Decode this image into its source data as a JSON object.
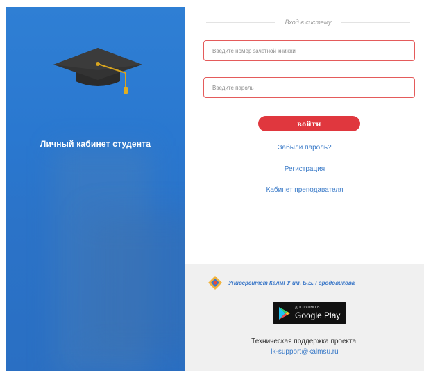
{
  "left_panel": {
    "title": "Личный кабинет студента",
    "icon": "graduation-cap-icon",
    "background_color": "#2b78d0"
  },
  "form": {
    "legend": "Вход в систему",
    "gradebook_placeholder": "Введите номер зачетной книжки",
    "password_placeholder": "Введите пароль",
    "login_label": "войти",
    "accent_color": "#e0373e"
  },
  "links": {
    "forgot_password": "Забыли пароль?",
    "registration": "Регистрация",
    "teacher_cabinet": "Кабинет преподавателя",
    "link_color": "#3b7bc8"
  },
  "footer": {
    "university": "Университет КалмГУ им. Б.Б. Городовикова",
    "google_play_small": "ДОСТУПНО В",
    "google_play_big": "Google Play",
    "support_text": "Техническая поддержка проекта:",
    "support_email": "lk-support@kalmsu.ru"
  }
}
